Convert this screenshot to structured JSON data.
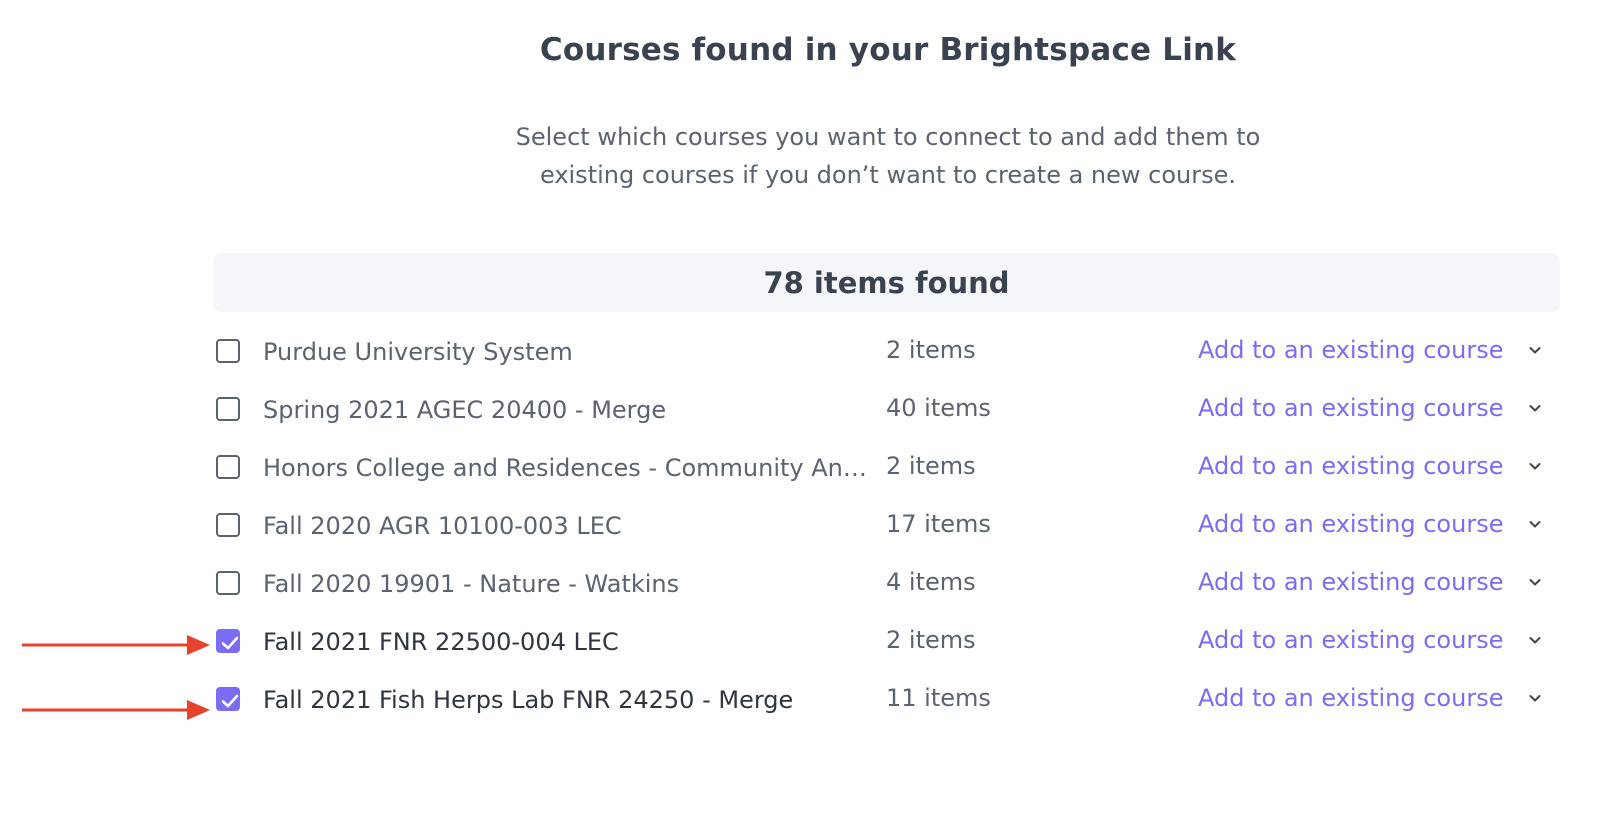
{
  "header": {
    "title": "Courses found in your Brightspace Link",
    "subtitle_line1": "Select which courses you want to connect to and add them to",
    "subtitle_line2": "existing courses if you don’t want to create a new course."
  },
  "summary": {
    "found_label": "78 items found"
  },
  "courses": [
    {
      "name": "Purdue University System",
      "count": "2 items",
      "action": "Add to an existing course",
      "checked": false
    },
    {
      "name": "Spring 2021 AGEC 20400 - Merge",
      "count": "40 items",
      "action": "Add to an existing course",
      "checked": false
    },
    {
      "name": "Honors College and Residences - Community And Engagement",
      "count": "2 items",
      "action": "Add to an existing course",
      "checked": false
    },
    {
      "name": "Fall 2020 AGR 10100-003 LEC",
      "count": "17 items",
      "action": "Add to an existing course",
      "checked": false
    },
    {
      "name": "Fall 2020 19901 - Nature - Watkins",
      "count": "4 items",
      "action": "Add to an existing course",
      "checked": false
    },
    {
      "name": "Fall 2021 FNR 22500-004 LEC",
      "count": "2 items",
      "action": "Add to an existing course",
      "checked": true
    },
    {
      "name": "Fall 2021 Fish Herps Lab FNR 24250 - Merge",
      "count": "11 items",
      "action": "Add to an existing course",
      "checked": true
    }
  ],
  "colors": {
    "accent": "#7b6cf6",
    "annotation_arrow": "#e8412c",
    "text": "#5b6271",
    "heading": "#3a4250"
  },
  "icons": {
    "checkbox_checked": "check-icon",
    "dropdown": "chevron-down-icon",
    "annotation": "arrow-right-icon"
  }
}
